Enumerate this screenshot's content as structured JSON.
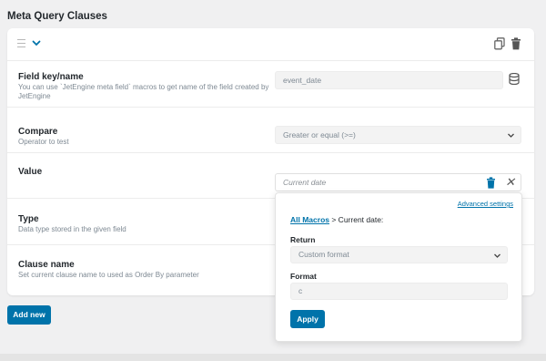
{
  "section_title": "Meta Query Clauses",
  "rows": {
    "field_key": {
      "label": "Field key/name",
      "desc": "You can use `JetEngine meta field` macros to get name of the field created by JetEngine",
      "value": "event_date"
    },
    "compare": {
      "label": "Compare",
      "desc": "Operator to test",
      "value": "Greater or equal (>=)"
    },
    "value": {
      "label": "Value",
      "placeholder": "Current date"
    },
    "type": {
      "label": "Type",
      "desc": "Data type stored in the given field"
    },
    "clause_name": {
      "label": "Clause name",
      "desc": "Set current clause name to used as Order By parameter"
    }
  },
  "popup": {
    "advanced_link": "Advanced settings",
    "all_macros_link": "All Macros",
    "macro_path": " > Current date:",
    "return_label": "Return",
    "return_value": "Custom format",
    "format_label": "Format",
    "format_value": "c",
    "apply_label": "Apply"
  },
  "add_new_label": "Add new",
  "icons": {
    "drag": "drag-handle-icon",
    "collapse": "chevron-down-icon",
    "copy": "copy-icon",
    "delete": "trash-icon",
    "dynamic": "database-icon",
    "close": "close-icon"
  },
  "colors": {
    "accent": "#0073aa",
    "background": "#f0f0f1"
  }
}
